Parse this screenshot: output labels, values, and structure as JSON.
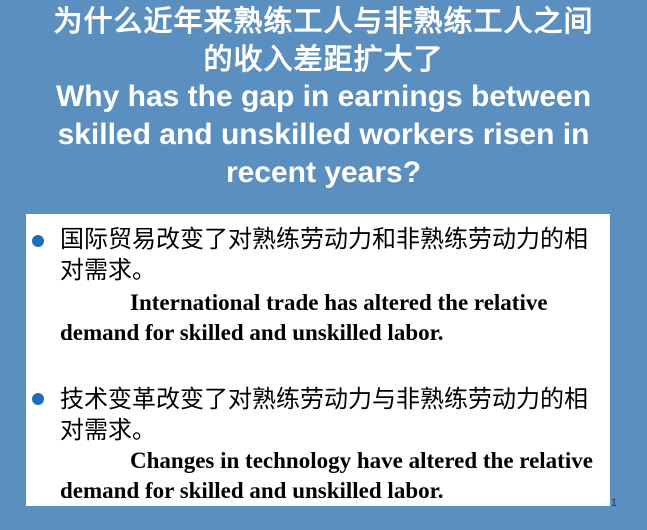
{
  "slide": {
    "title_zh_line1": "为什么近年来熟练工人与非熟练工人之间",
    "title_zh_line2": "的收入差距扩大了",
    "title_en": "Why has the gap in earnings between skilled and unskilled workers risen in recent years?",
    "bullets": [
      {
        "zh": "国际贸易改变了对熟练劳动力和非熟练劳动力的相对需求。",
        "en": "International trade has altered the relative demand for skilled and unskilled labor."
      },
      {
        "zh": "技术变革改变了对熟练劳动力与非熟练劳动力的相对需求。",
        "en": "Changes in technology have altered the relative demand for skilled and unskilled labor."
      }
    ],
    "page_number": "1"
  },
  "colors": {
    "background": "#5b8fbf",
    "title_text": "#ffffff",
    "content_background": "#ffffff",
    "bullet": "#1f6fb8",
    "body_text": "#000000"
  }
}
